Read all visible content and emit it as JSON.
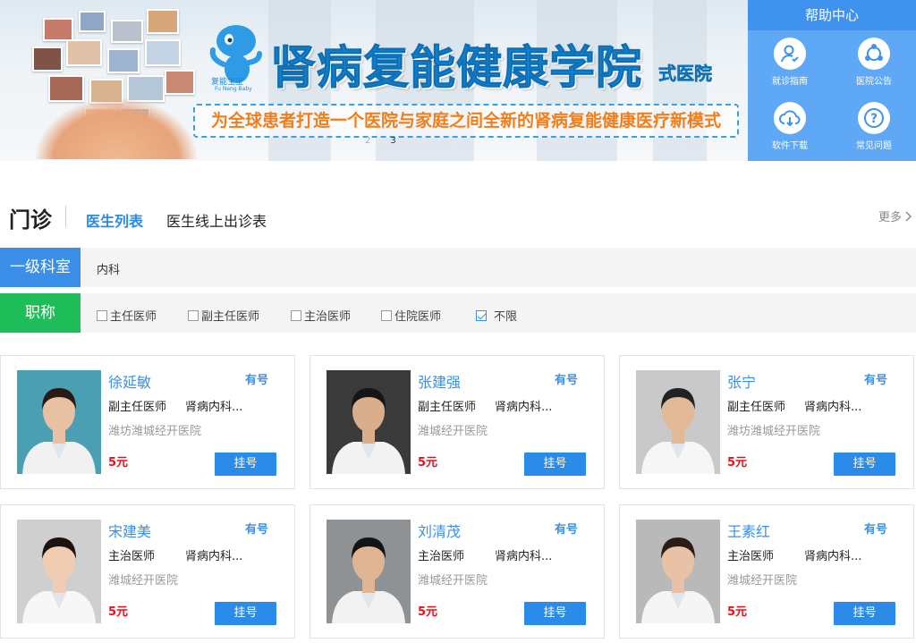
{
  "banner": {
    "mascot_label": "复能宝宝",
    "mascot_sub": "Fu Neng Baby",
    "title": "肾病复能健康学院",
    "title_suffix": "式医院",
    "slogan": "为全球患者打造一个医院与家庭之间全新的肾病复能健康医疗新模式",
    "slides": [
      "2",
      "3"
    ],
    "active_slide": "3"
  },
  "help": {
    "title": "帮助中心",
    "items": [
      {
        "label": "就诊指南",
        "icon": "user-guide-icon"
      },
      {
        "label": "医院公告",
        "icon": "share-icon"
      },
      {
        "label": "软件下载",
        "icon": "cloud-download-icon"
      },
      {
        "label": "常见问题",
        "icon": "question-icon"
      }
    ]
  },
  "tabs": {
    "heading": "门诊",
    "tab1": "医生列表",
    "tab2": "医生线上出诊表",
    "more": "更多"
  },
  "filters": {
    "dept_label": "一级科室",
    "dept_value": "内科",
    "title_label": "职称",
    "options": [
      {
        "label": "主任医师",
        "checked": false
      },
      {
        "label": "副主任医师",
        "checked": false
      },
      {
        "label": "主治医师",
        "checked": false
      },
      {
        "label": "住院医师",
        "checked": false
      },
      {
        "label": "不限",
        "checked": true
      }
    ]
  },
  "doctors": [
    {
      "name": "徐延敏",
      "status": "有号",
      "rank": "副主任医师",
      "dept": "肾病内科...",
      "hospital": "潍坊潍城经开医院",
      "price": "5元",
      "button": "挂号"
    },
    {
      "name": "张建强",
      "status": "有号",
      "rank": "副主任医师",
      "dept": "肾病内科...",
      "hospital": "潍城经开医院",
      "price": "5元",
      "button": "挂号"
    },
    {
      "name": "张宁",
      "status": "有号",
      "rank": "副主任医师",
      "dept": "肾病内科...",
      "hospital": "潍坊潍城经开医院",
      "price": "5元",
      "button": "挂号"
    },
    {
      "name": "宋建美",
      "status": "有号",
      "rank": "主治医师",
      "dept": "肾病内科...",
      "hospital": "潍城经开医院",
      "price": "5元",
      "button": "挂号"
    },
    {
      "name": "刘清茂",
      "status": "有号",
      "rank": "主治医师",
      "dept": "肾病内科...",
      "hospital": "潍城经开医院",
      "price": "5元",
      "button": "挂号"
    },
    {
      "name": "王素红",
      "status": "有号",
      "rank": "主治医师",
      "dept": "肾病内科...",
      "hospital": "潍城经开医院",
      "price": "5元",
      "button": "挂号"
    }
  ],
  "colors": {
    "accent": "#3b8fe8",
    "green": "#1ebd5a",
    "price": "#e8101a",
    "help_bg": "#5ea8f5"
  }
}
